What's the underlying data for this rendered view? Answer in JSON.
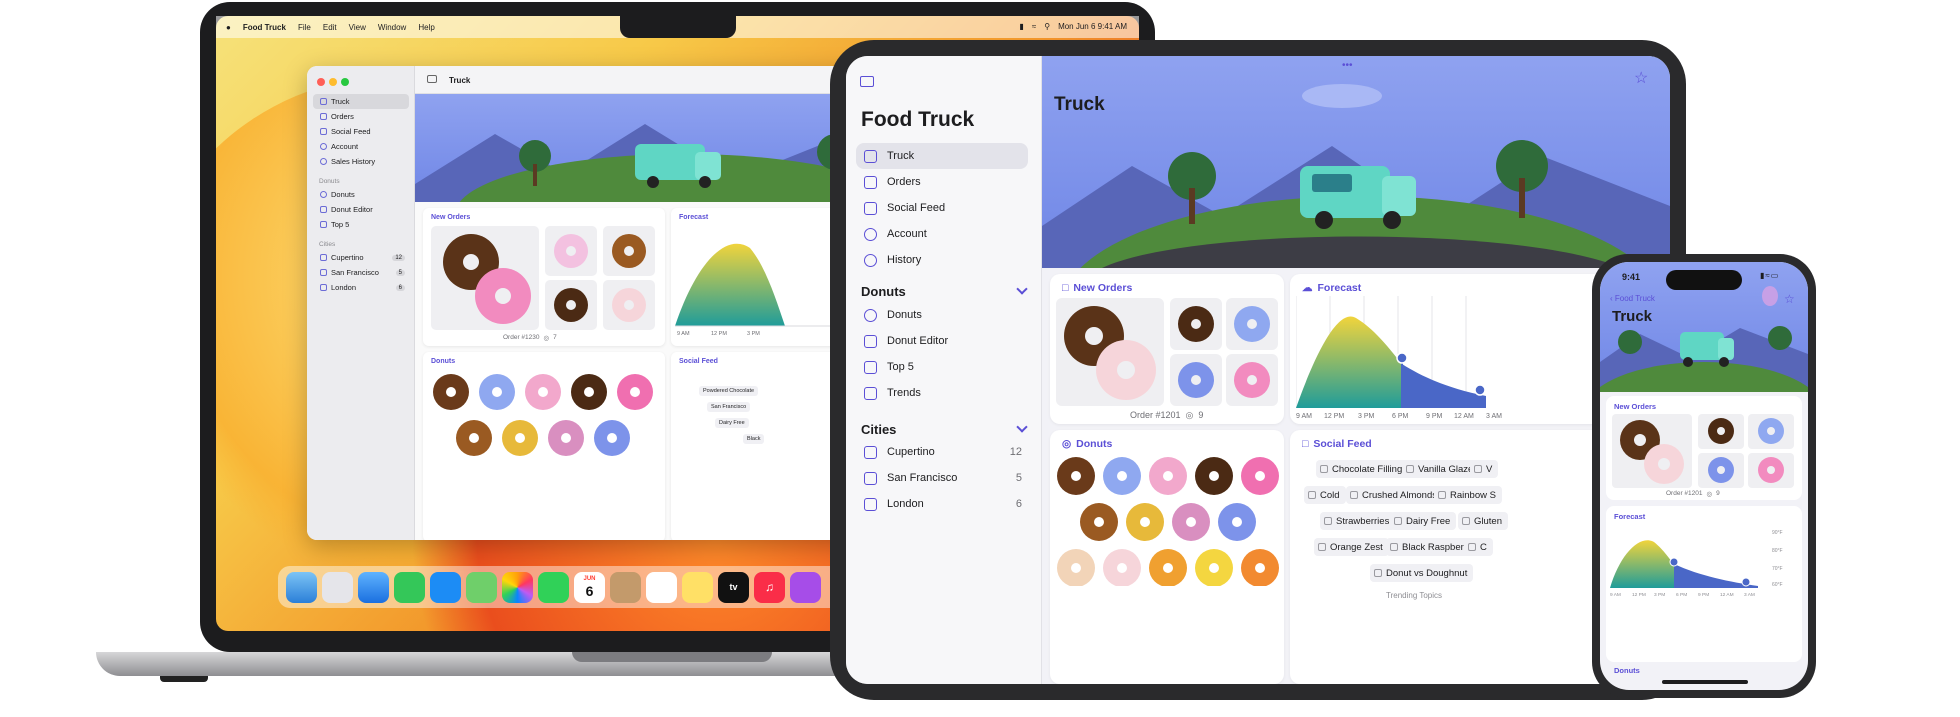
{
  "mac": {
    "menubar": {
      "app": "Food Truck",
      "menus": [
        "File",
        "Edit",
        "View",
        "Window",
        "Help"
      ],
      "clock": "Mon Jun 6  9:41 AM"
    },
    "window_title": "Truck",
    "sidebar": {
      "items": [
        {
          "label": "Truck",
          "icon": "truck-icon"
        },
        {
          "label": "Orders",
          "icon": "box-icon"
        },
        {
          "label": "Social Feed",
          "icon": "message-icon"
        },
        {
          "label": "Account",
          "icon": "person-icon"
        },
        {
          "label": "Sales History",
          "icon": "clock-icon"
        }
      ],
      "donuts_header": "Donuts",
      "donut_items": [
        {
          "label": "Donuts",
          "icon": "donut-icon"
        },
        {
          "label": "Donut Editor",
          "icon": "sliders-icon"
        },
        {
          "label": "Top 5",
          "icon": "trophy-icon"
        }
      ],
      "cities_header": "Cities",
      "cities": [
        {
          "label": "Cupertino",
          "count": "12"
        },
        {
          "label": "San Francisco",
          "count": "5"
        },
        {
          "label": "London",
          "count": "6"
        }
      ]
    },
    "cards": {
      "new_orders": "New Orders",
      "order_caption": "Order #1230",
      "order_count": "7",
      "forecast": "Forecast",
      "forecast_ticks": [
        "9 AM",
        "12 PM",
        "3 PM"
      ],
      "donuts": "Donuts",
      "social_feed": "Social Feed",
      "tags": [
        "Powdered Chocolate",
        "San Francisco",
        "Dairy Free",
        "Black"
      ]
    },
    "dock_date": {
      "month": "JUN",
      "day": "6"
    }
  },
  "ipad": {
    "app_title": "Food Truck",
    "page_title": "Truck",
    "sidebar": {
      "items": [
        {
          "label": "Truck",
          "icon": "truck-icon"
        },
        {
          "label": "Orders",
          "icon": "box-icon"
        },
        {
          "label": "Social Feed",
          "icon": "message-icon"
        },
        {
          "label": "Account",
          "icon": "person-icon"
        },
        {
          "label": "History",
          "icon": "clock-icon"
        }
      ],
      "donuts_header": "Donuts",
      "donut_items": [
        {
          "label": "Donuts",
          "icon": "donut-icon"
        },
        {
          "label": "Donut Editor",
          "icon": "sliders-icon"
        },
        {
          "label": "Top 5",
          "icon": "trophy-icon"
        },
        {
          "label": "Trends",
          "icon": "chart-icon"
        }
      ],
      "cities_header": "Cities",
      "cities": [
        {
          "label": "Cupertino",
          "count": "12"
        },
        {
          "label": "San Francisco",
          "count": "5"
        },
        {
          "label": "London",
          "count": "6"
        }
      ]
    },
    "cards": {
      "new_orders": "New Orders",
      "order_caption": "Order #1201",
      "order_count": "9",
      "forecast": "Forecast",
      "forecast_ticks": [
        "9 AM",
        "12 PM",
        "3 PM",
        "6 PM",
        "9 PM",
        "12 AM",
        "3 AM"
      ],
      "donuts": "Donuts",
      "social_feed": "Social Feed",
      "tags": [
        [
          "Chocolate Filling",
          "Vanilla Glaze",
          "V"
        ],
        [
          "Cold",
          "Crushed Almonds",
          "Rainbow S"
        ],
        [
          "Strawberries",
          "Dairy Free",
          "Gluten"
        ],
        [
          "Orange Zest",
          "Black Raspberry",
          "C"
        ],
        [
          "Donut vs Doughnut"
        ]
      ],
      "trending_caption": "Trending Topics"
    }
  },
  "iphone": {
    "time": "9:41",
    "back_label": "Food Truck",
    "page_title": "Truck",
    "new_orders": "New Orders",
    "order_caption": "Order #1201",
    "order_count": "9",
    "forecast": "Forecast",
    "forecast_ticks": [
      "9 AM",
      "12 PM",
      "3 PM",
      "6 PM",
      "9 PM",
      "12 AM",
      "3 AM"
    ],
    "forecast_y_ticks": [
      "90°F",
      "80°F",
      "70°F",
      "60°F"
    ],
    "donuts": "Donuts"
  },
  "colors": {
    "accent": "#5b4fd6",
    "banner_sky": "#6f86e6",
    "hill_green": "#4f8a3c",
    "truck_teal": "#5fd6c4",
    "forecast_fill_top": "#f1d43c",
    "forecast_fill_bottom": "#1f9c9a",
    "forecast_future": "#4a67c7"
  }
}
